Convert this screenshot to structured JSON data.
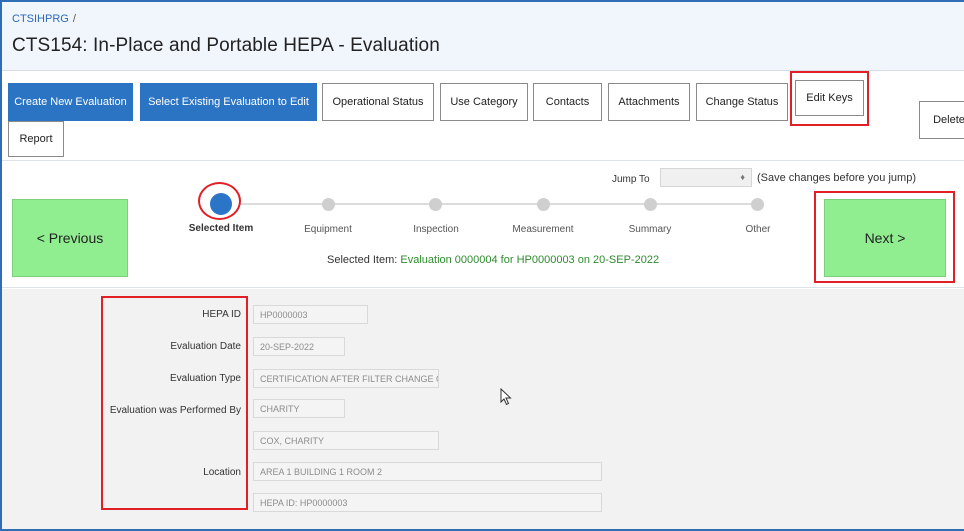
{
  "header": {
    "breadcrumb": "CTSIHPRG",
    "breadcrumb_sep": "/",
    "title": "CTS154: In-Place and Portable HEPA - Evaluation"
  },
  "toolbar": {
    "create_new": "Create New Evaluation",
    "select_existing": "Select Existing Evaluation to Edit",
    "operational_status": "Operational Status",
    "use_category": "Use Category",
    "contacts": "Contacts",
    "attachments": "Attachments",
    "change_status": "Change Status",
    "edit_keys": "Edit Keys",
    "delete": "Delete",
    "report": "Report"
  },
  "wizard": {
    "previous": "< Previous",
    "next": "Next >",
    "jump_label": "Jump To",
    "jump_value": "",
    "jump_hint": "(Save changes before you jump)",
    "steps": [
      {
        "label": "Selected Item",
        "active": true
      },
      {
        "label": "Equipment",
        "active": false
      },
      {
        "label": "Inspection",
        "active": false
      },
      {
        "label": "Measurement",
        "active": false
      },
      {
        "label": "Summary",
        "active": false
      },
      {
        "label": "Other",
        "active": false
      }
    ],
    "selected_prefix": "Selected Item: ",
    "selected_value": "Evaluation 0000004 for HP0000003 on 20-SEP-2022"
  },
  "form": {
    "hepa_id_label": "HEPA ID",
    "hepa_id_value": "HP0000003",
    "eval_date_label": "Evaluation Date",
    "eval_date_value": "20-SEP-2022",
    "eval_type_label": "Evaluation Type",
    "eval_type_value": "CERTIFICATION AFTER FILTER CHANGE OUT",
    "performed_by_label": "Evaluation was Performed By",
    "performed_by_value": "CHARITY",
    "performed_by_name": "COX, CHARITY",
    "location_label": "Location",
    "location_value": "AREA 1 BUILDING 1 ROOM 2",
    "location_hepa": "HEPA ID: HP0000003"
  },
  "colors": {
    "primary": "#2b74c4",
    "nav_green": "#90ee90",
    "highlight_red": "#e01f26",
    "selected_green": "#2e8b2e"
  }
}
